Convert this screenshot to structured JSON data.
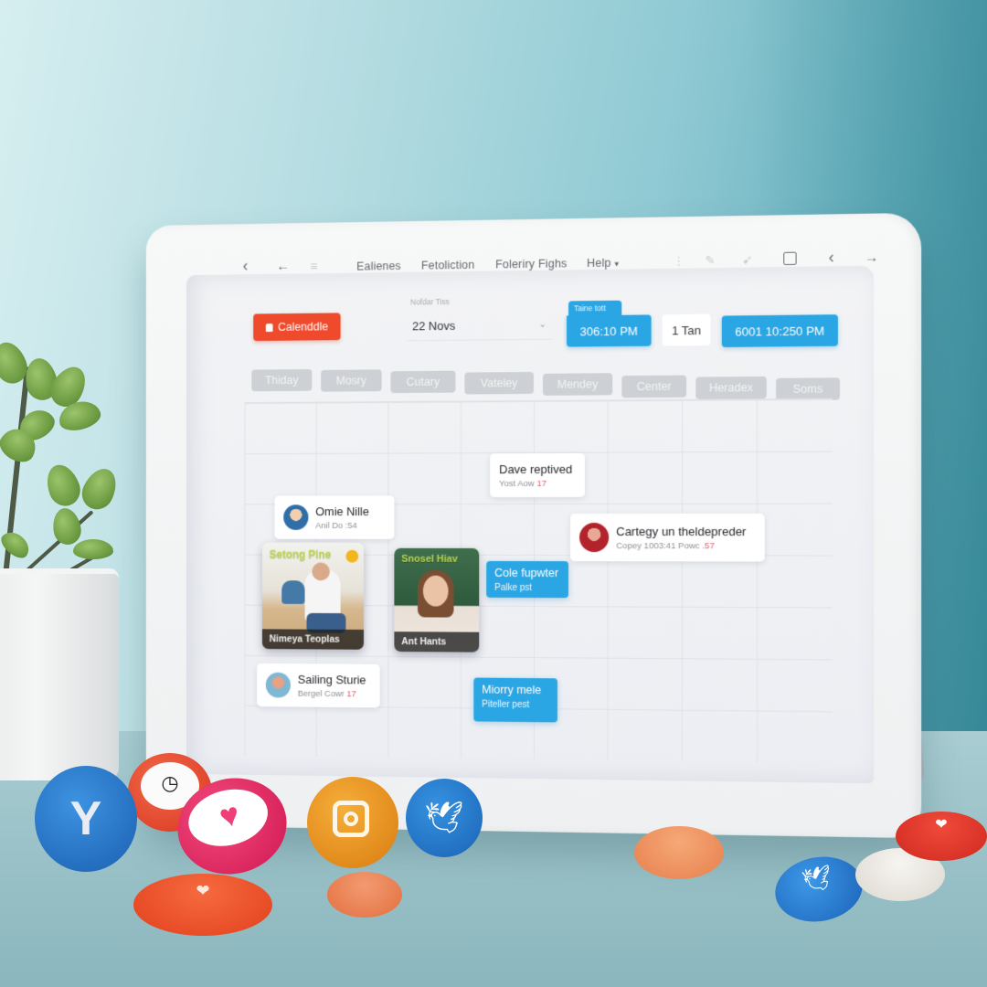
{
  "app": {
    "menu": [
      "Ealienes",
      "Fetoliction",
      "Foleriry Fighs",
      "Help"
    ],
    "help_caret": "▾",
    "nav_icons": [
      "back-chevron-icon",
      "back-arrow-icon",
      "menu-lines-icon"
    ],
    "tool_icons": [
      "info-icon",
      "edit-icon",
      "tag-icon",
      "window-icon",
      "chevron-left-icon",
      "arrow-right-icon"
    ]
  },
  "toolbar": {
    "primary_button": "Calenddle",
    "date_label": "Nofdar Tiss",
    "date_value": "22 Novs",
    "start_time_label": "Taine tott",
    "start_time": "306:10 PM",
    "duration": "1 Tan",
    "end_time": "6001 10:250 PM"
  },
  "day_chips": [
    "Thiday",
    "Mosry",
    "Cutary",
    "Vateley",
    "Mendey",
    "Center",
    "Heradex",
    "Soms"
  ],
  "events": {
    "dave": {
      "title": "Dave reptived",
      "sub": "Yost Aow",
      "sub_mark": "17"
    },
    "omie": {
      "title": "Omie Nille",
      "sub": "Anil Do :54"
    },
    "cartey": {
      "title": "Cartegy un theldepreder",
      "sub": "Copey 1003:41 Powc",
      "sub_mark": ".57"
    },
    "setong": {
      "title": "Setong Pine",
      "caption": "Nimeya Teoplas"
    },
    "snosel": {
      "title": "Snosel Hiav",
      "caption": "Ant Hants"
    },
    "cole": {
      "title": "Cole fupwter",
      "sub": "Palke pst"
    },
    "sailing": {
      "title": "Sailing Sturie",
      "sub": "Bergel Cowr",
      "sub_mark": "17"
    },
    "miorry": {
      "title": "Miorry mele",
      "sub": "Piteller pest"
    }
  },
  "colors": {
    "accent_blue": "#2aa6e4",
    "primary_red": "#ee4a2b",
    "chip_gray": "#cdd0d4"
  },
  "social_tokens": [
    "yelp-like-icon",
    "clock-icon",
    "heart-icon",
    "instagram-icon",
    "twitter-icon",
    "twitter-icon",
    "heart-icon"
  ]
}
